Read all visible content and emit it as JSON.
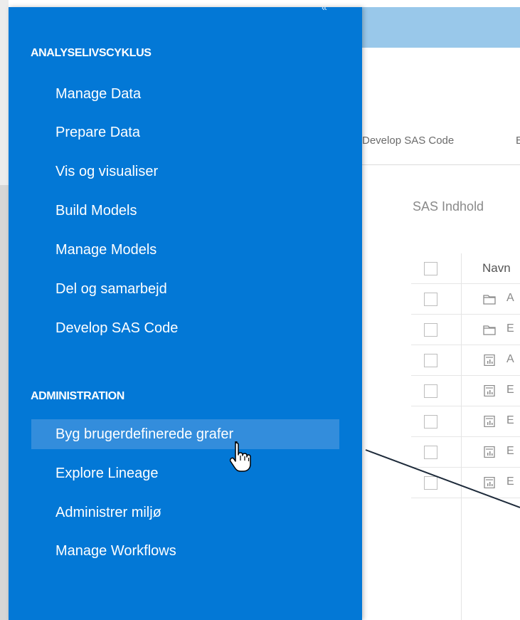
{
  "background_app": {
    "tabs": [
      {
        "label": "Develop SAS Code"
      },
      {
        "label": "E"
      }
    ],
    "content_title": "SAS Indhold",
    "table": {
      "header": "Navn",
      "rows": [
        {
          "icon": "folder-icon",
          "name": "A"
        },
        {
          "icon": "folder-icon",
          "name": "E"
        },
        {
          "icon": "report-icon",
          "name": "A"
        },
        {
          "icon": "report-icon",
          "name": "E"
        },
        {
          "icon": "report-icon",
          "name": "E"
        },
        {
          "icon": "report-icon",
          "name": "E"
        },
        {
          "icon": "report-icon",
          "name": "E"
        }
      ]
    }
  },
  "nav": {
    "collapse_icon": "double-chevron-left-icon",
    "sections": [
      {
        "heading": "ANALYSELIVSCYKLUS",
        "items": [
          {
            "label": "Manage Data"
          },
          {
            "label": "Prepare Data"
          },
          {
            "label": "Vis og visualiser"
          },
          {
            "label": "Build Models"
          },
          {
            "label": "Manage Models"
          },
          {
            "label": "Del og samarbejd"
          },
          {
            "label": "Develop SAS Code"
          }
        ]
      },
      {
        "heading": "ADMINISTRATION",
        "items": [
          {
            "label": "Byg brugerdefinerede grafer",
            "hovered": true
          },
          {
            "label": "Explore Lineage"
          },
          {
            "label": "Administrer miljø"
          },
          {
            "label": "Manage Workflows"
          }
        ]
      }
    ]
  },
  "cursor": "hand-pointer-icon",
  "colors": {
    "nav_background": "#0378d6",
    "nav_hover": "#338ddc",
    "topbar": "#99c8ea",
    "nav_text": "#ffffff"
  }
}
